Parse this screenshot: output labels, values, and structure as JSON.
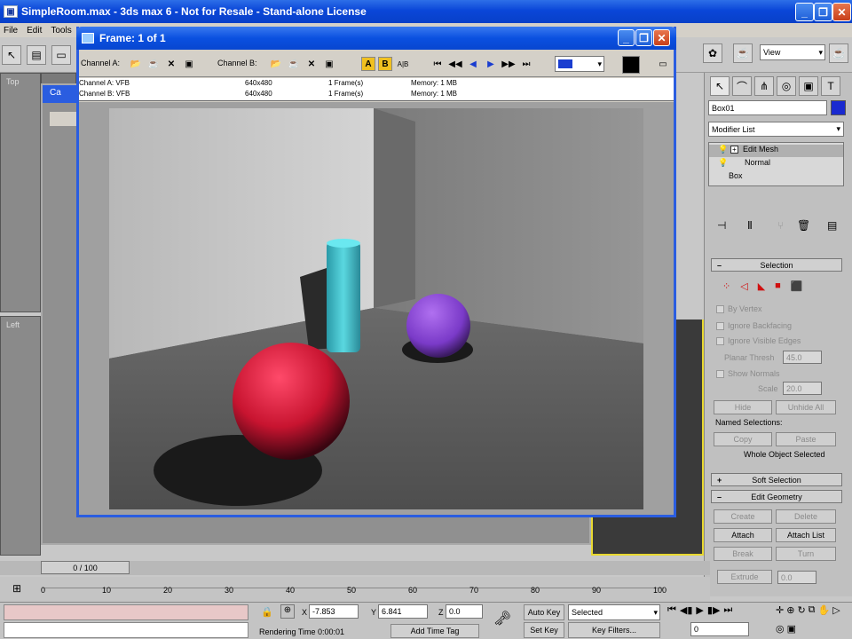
{
  "app": {
    "title": "SimpleRoom.max - 3ds max 6 - Not for Resale - Stand-alone License",
    "menu": [
      "File",
      "Edit",
      "Tools"
    ]
  },
  "toolbar": {
    "view_dropdown": "View"
  },
  "viewports": {
    "top_label": "Top",
    "left_label": "Left",
    "camera_tab_label": "Ca"
  },
  "frame_window": {
    "title": "Frame: 1 of 1",
    "channel_a_label": "Channel A:",
    "channel_b_label": "Channel B:",
    "btn_a": "A",
    "btn_b": "B",
    "btn_ab": "A|B",
    "info_rows": [
      {
        "channel": "Channel A: VFB",
        "size": "640x480",
        "frames": "1 Frame(s)",
        "memory": "Memory: 1 MB"
      },
      {
        "channel": "Channel B: VFB",
        "size": "640x480",
        "frames": "1 Frame(s)",
        "memory": "Memory: 1 MB"
      }
    ]
  },
  "command_panel": {
    "object_name": "Box01",
    "object_color": "#1a2ad0",
    "modifier_list": "Modifier List",
    "stack": [
      "Edit Mesh",
      "Normal",
      "Box"
    ],
    "selection_rollout": "Selection",
    "by_vertex": "By Vertex",
    "ignore_backfacing": "Ignore Backfacing",
    "ignore_visible_edges": "Ignore Visible Edges",
    "planar_thresh_label": "Planar Thresh",
    "planar_thresh_value": "45.0",
    "show_normals": "Show Normals",
    "scale_label": "Scale",
    "scale_value": "20.0",
    "hide": "Hide",
    "unhide_all": "Unhide All",
    "named_selections": "Named Selections:",
    "copy": "Copy",
    "paste": "Paste",
    "whole_object_selected": "Whole Object Selected",
    "soft_selection": "Soft Selection",
    "edit_geometry": "Edit Geometry",
    "create": "Create",
    "delete": "Delete",
    "attach": "Attach",
    "attach_list": "Attach List",
    "break": "Break",
    "turn": "Turn",
    "extrude": "Extrude",
    "extrude_value": "0.0"
  },
  "timeline": {
    "slider_label": "0 / 100",
    "ticks": [
      "0",
      "10",
      "20",
      "30",
      "40",
      "50",
      "60",
      "70",
      "80",
      "90",
      "100"
    ]
  },
  "status": {
    "x_label": "X",
    "x_value": "-7.853",
    "y_label": "Y",
    "y_value": "6.841",
    "z_label": "Z",
    "z_value": "0.0",
    "auto_key": "Auto Key",
    "selected": "Selected",
    "set_key": "Set Key",
    "key_filters": "Key Filters...",
    "rendering_time": "Rendering Time  0:00:01",
    "add_time_tag": "Add Time Tag",
    "frame_value": "0"
  }
}
